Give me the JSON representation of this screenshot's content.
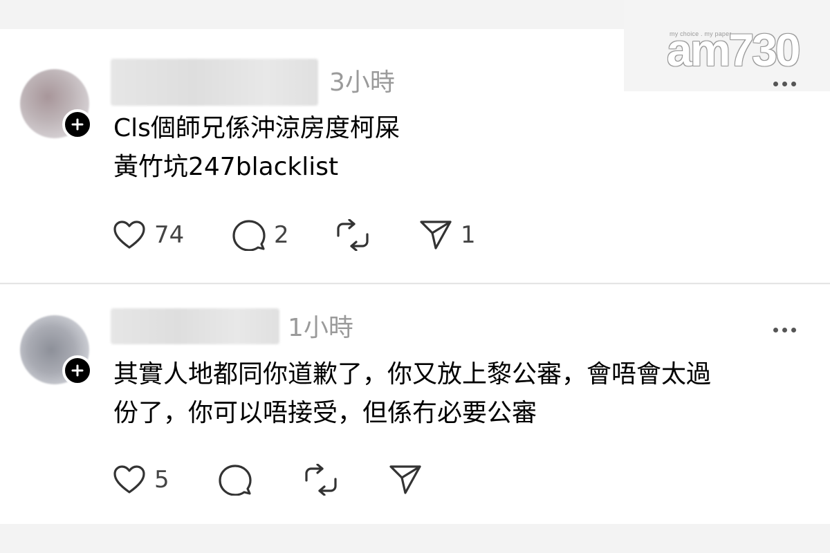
{
  "watermark": {
    "tagline": "my choice . my paper",
    "brand": "am730"
  },
  "posts": [
    {
      "timestamp": "3小時",
      "text_lines": [
        "Cls個師兄係沖涼房度柯屎",
        "黃竹坑247blacklist"
      ],
      "likes": "74",
      "replies": "2",
      "reposts": "",
      "shares": "1"
    },
    {
      "timestamp": "1小時",
      "text_lines": [
        "其實人地都同你道歉了，你又放上黎公審，會唔會太過",
        "份了，你可以唔接受，但係冇必要公審"
      ],
      "likes": "5",
      "replies": "",
      "reposts": "",
      "shares": ""
    }
  ],
  "icons": {
    "like": "heart-icon",
    "reply": "comment-bubble-icon",
    "repost": "repost-arrows-icon",
    "share": "send-paper-plane-icon",
    "more": "ellipsis-icon",
    "follow": "plus-icon"
  },
  "colors": {
    "background": "#ffffff",
    "timestamp": "#9a9a9a",
    "icon": "#444444",
    "follow_button": "#000000"
  }
}
